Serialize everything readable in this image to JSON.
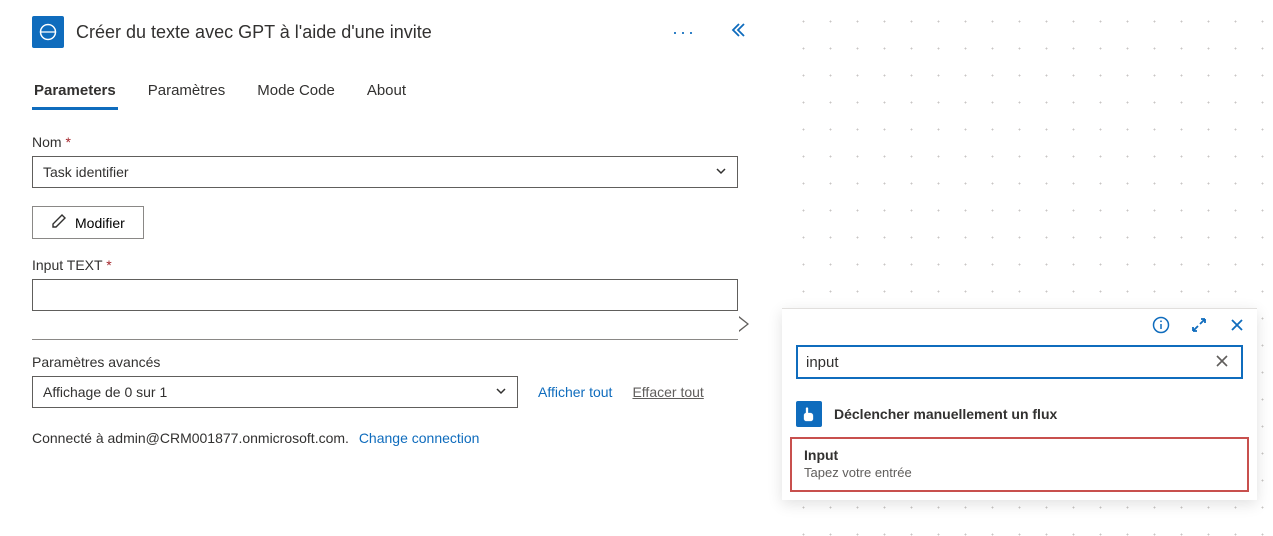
{
  "header": {
    "title": "Créer du texte avec GPT à l'aide d'une invite"
  },
  "tabs": [
    {
      "label": "Parameters",
      "active": true
    },
    {
      "label": "Paramètres",
      "active": false
    },
    {
      "label": "Mode Code",
      "active": false
    },
    {
      "label": "About",
      "active": false
    }
  ],
  "fields": {
    "nom_label": "Nom",
    "nom_value": "Task identifier",
    "modify_label": "Modifier",
    "input_text_label": "Input TEXT"
  },
  "advanced": {
    "section_label": "Paramètres avancés",
    "dropdown_value": "Affichage de 0 sur 1",
    "show_all": "Afficher tout",
    "clear_all": "Effacer tout"
  },
  "connection": {
    "prefix": "Connecté à ",
    "account": "admin@CRM001877.onmicrosoft.com.",
    "change_link": "Change connection"
  },
  "popup": {
    "search_value": "input",
    "trigger_title": "Déclencher manuellement un flux",
    "result_title": "Input",
    "result_subtitle": "Tapez votre entrée"
  }
}
